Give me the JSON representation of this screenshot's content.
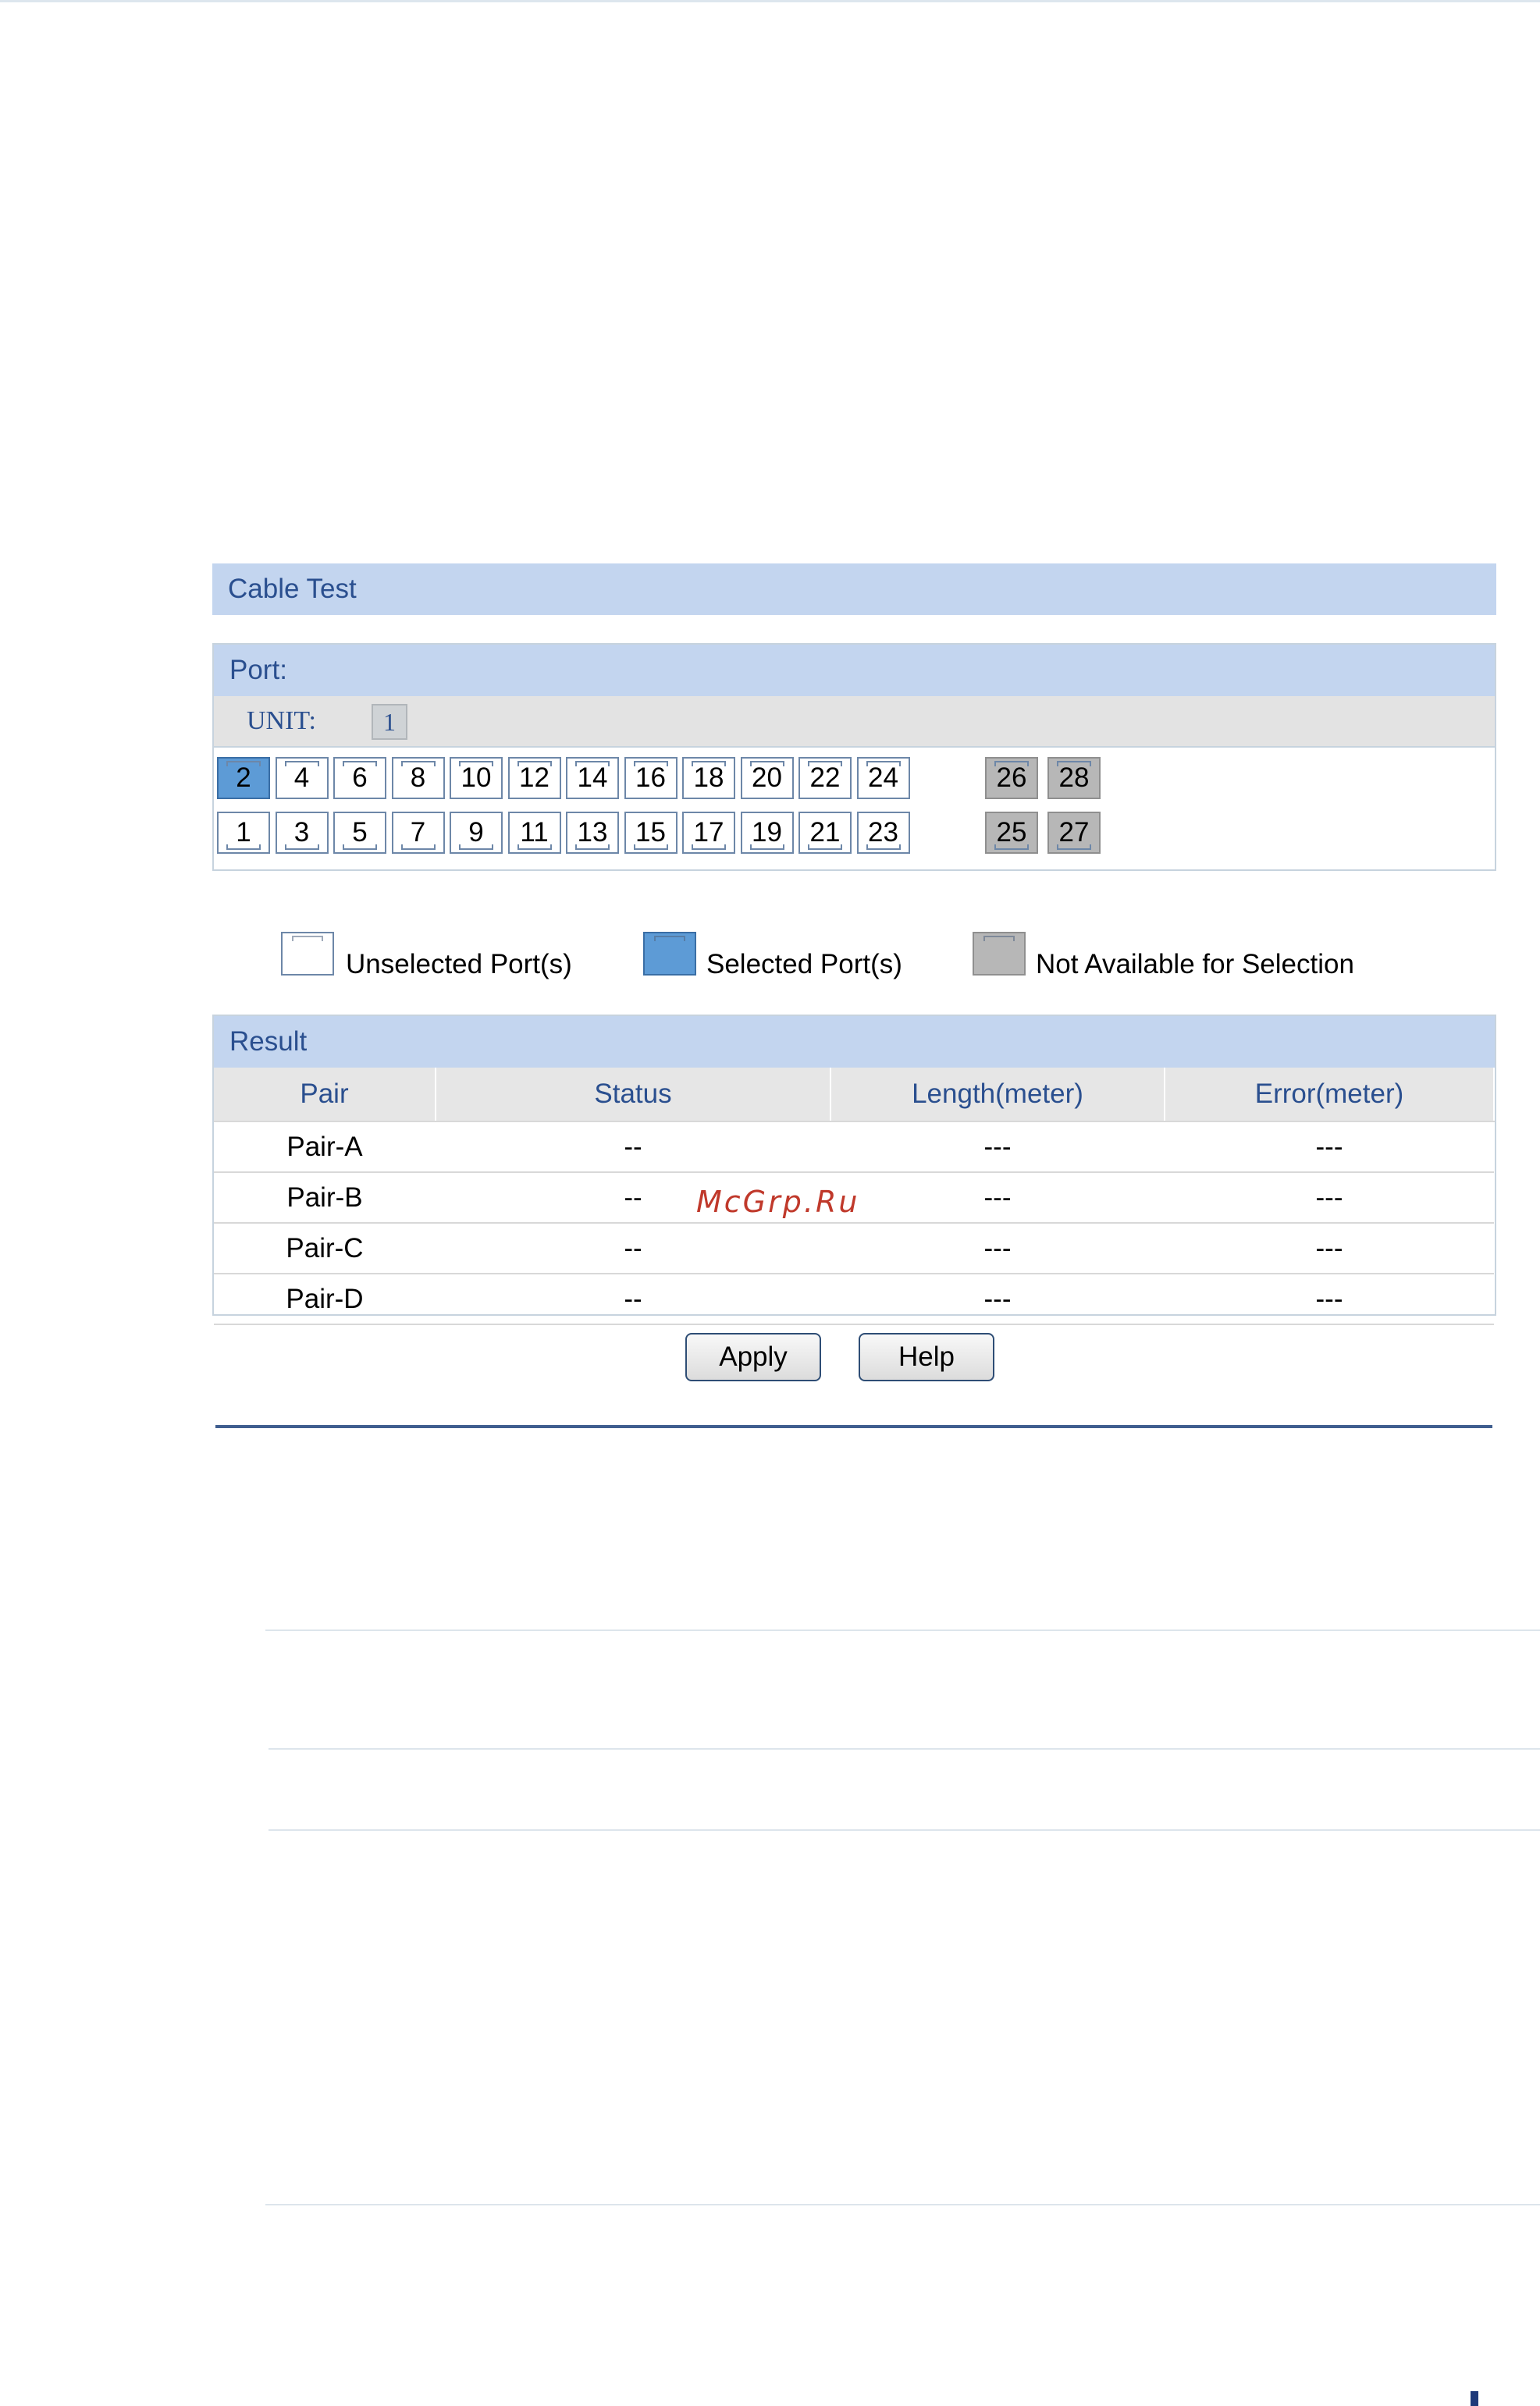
{
  "cable_test": {
    "title": "Cable Test"
  },
  "port": {
    "title": "Port:",
    "unit_label": "UNIT:",
    "unit_value": "1",
    "top_row": [
      "2",
      "4",
      "6",
      "8",
      "10",
      "12",
      "14",
      "16",
      "18",
      "20",
      "22",
      "24"
    ],
    "bottom_row": [
      "1",
      "3",
      "5",
      "7",
      "9",
      "11",
      "13",
      "15",
      "17",
      "19",
      "21",
      "23"
    ],
    "top_extra": [
      "26",
      "28"
    ],
    "bottom_extra": [
      "25",
      "27"
    ],
    "selected": [
      "2"
    ],
    "not_available": [
      "25",
      "26",
      "27",
      "28"
    ]
  },
  "legend": {
    "unselected": "Unselected Port(s)",
    "selected": "Selected Port(s)",
    "not_available": "Not Available for Selection"
  },
  "result": {
    "title": "Result",
    "columns": [
      "Pair",
      "Status",
      "Length(meter)",
      "Error(meter)"
    ],
    "rows": [
      [
        "Pair-A",
        "--",
        "---",
        "---"
      ],
      [
        "Pair-B",
        "--",
        "---",
        "---"
      ],
      [
        "Pair-C",
        "--",
        "---",
        "---"
      ],
      [
        "Pair-D",
        "--",
        "---",
        "---"
      ]
    ]
  },
  "buttons": {
    "apply": "Apply",
    "help": "Help"
  },
  "watermark": "McGrp.Ru",
  "colors": {
    "header_bar": "#c3d5ef",
    "selected_port": "#5d9bd6",
    "unavailable_port": "#b7b7b7",
    "divider": "#3f5e8f"
  }
}
